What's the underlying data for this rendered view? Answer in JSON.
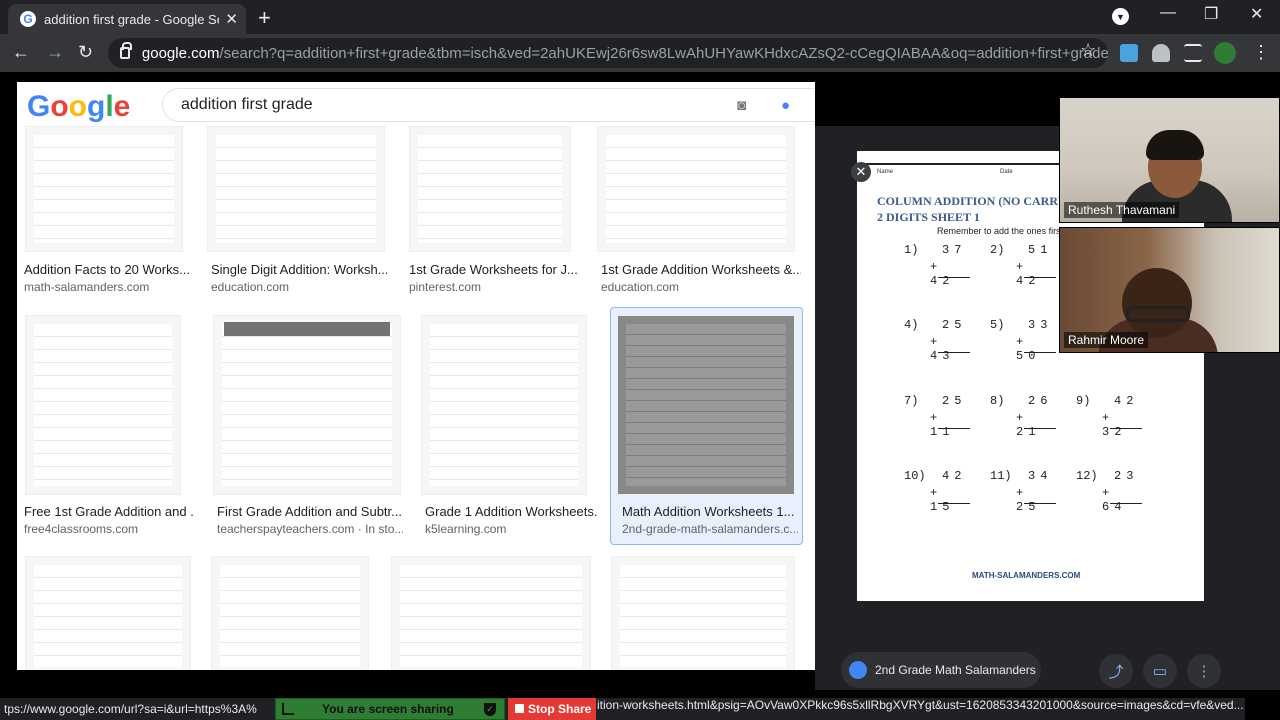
{
  "tab": {
    "title": "addition first grade - Google Sea",
    "close": "✕",
    "favicon": "G"
  },
  "window": {
    "new_tab": "+",
    "minimize": "—",
    "maximize": "❐",
    "close": "✕",
    "profile": "▼"
  },
  "toolbar": {
    "back": "←",
    "forward": "→",
    "reload": "↻",
    "star": "☆",
    "url_host": "google.com",
    "url_path": "/search?q=addition+first+grade&tbm=isch&ved=2ahUKEwj26r6sw8LwAhUHYawKHdxcAZsQ2-cCegQIABAA&oq=addition+first+grade..."
  },
  "search": {
    "logo": "Google",
    "query": "addition first grade"
  },
  "results": [
    {
      "title": "Addition Facts to 20 Works...",
      "source": "math-salamanders.com"
    },
    {
      "title": "Single Digit Addition: Worksh...",
      "source": "education.com"
    },
    {
      "title": "1st Grade Worksheets for J...",
      "source": "pinterest.com"
    },
    {
      "title": "1st Grade Addition Worksheets &...",
      "source": "education.com"
    },
    {
      "title": "Free 1st Grade Addition and ...",
      "source": "free4classrooms.com"
    },
    {
      "title": "First Grade Addition and Subtr...",
      "source": "teacherspayteachers.com · In sto..."
    },
    {
      "title": "Grade 1 Addition Worksheets...",
      "source": "k5learning.com"
    },
    {
      "title": "Math Addition Worksheets 1...",
      "source": "2nd-grade-math-salamanders.c..."
    }
  ],
  "preview": {
    "close": "✕",
    "header_name": "Name",
    "header_date": "Date",
    "title_line1": "COLUMN ADDITION (NO CARRYI",
    "title_line2": "2 DIGITS SHEET 1",
    "instruction": "Remember to add the ones first",
    "problems": [
      {
        "n": "1)",
        "a": "37",
        "b": "+ 42"
      },
      {
        "n": "2)",
        "a": "51",
        "b": "+ 42"
      },
      {
        "n": "4)",
        "a": "25",
        "b": "+ 43"
      },
      {
        "n": "5)",
        "a": "33",
        "b": "+ 50"
      },
      {
        "n": "7)",
        "a": "25",
        "b": "+ 11"
      },
      {
        "n": "8)",
        "a": "26",
        "b": "+ 21"
      },
      {
        "n": "9)",
        "a": "42",
        "b": "+ 32"
      },
      {
        "n": "10)",
        "a": "42",
        "b": "+ 15"
      },
      {
        "n": "11)",
        "a": "34",
        "b": "+ 25"
      },
      {
        "n": "12)",
        "a": "23",
        "b": "+ 64"
      }
    ],
    "logo_text": "MATH-SALAMANDERS.COM",
    "site": "2nd Grade Math Salamanders",
    "share_icon": "⤴",
    "save_icon": "▭",
    "more_icon": "⋮"
  },
  "participants": [
    {
      "name": "Ruthesh Thavamani"
    },
    {
      "name": "Rahmir Moore"
    }
  ],
  "status": {
    "left": "tps://www.google.com/url?sa=i&url=https%3A%",
    "right": "ition-worksheets.html&psig=AOvVaw0XPkkc96s5xllRbgXVRYgt&ust=1620853343201000&source=images&cd=vfe&ved..."
  },
  "share_banner": {
    "label": "You are screen sharing",
    "stop": "Stop Share"
  },
  "colors": {
    "accent": "#8ab4f8",
    "share_green": "#2e7d32",
    "stop_red": "#e53935"
  }
}
